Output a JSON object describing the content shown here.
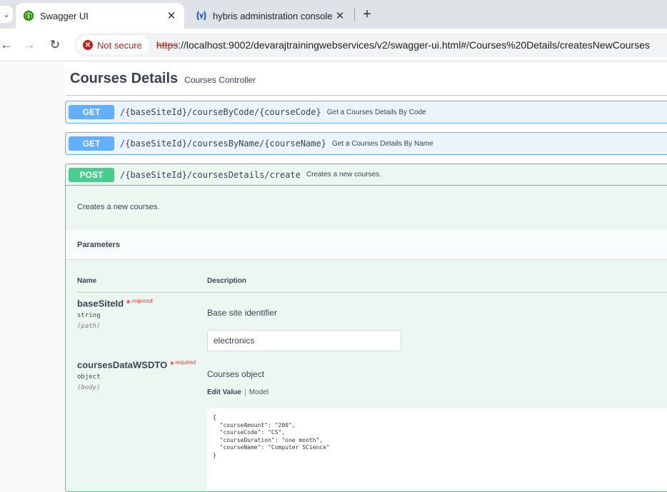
{
  "browser": {
    "tabs": [
      {
        "title": "Swagger UI",
        "active": true,
        "icon": "swagger-icon"
      },
      {
        "title": "hybris administration console |",
        "active": false,
        "icon": "hybris-icon"
      }
    ],
    "not_secure_label": "Not secure",
    "url_scheme": "https",
    "url_rest": "://localhost:9002/devarajtrainingwebservices/v2/swagger-ui.html#/Courses%20Details/createsNewCourses"
  },
  "section": {
    "title": "Courses Details",
    "subtitle": "Courses Controller"
  },
  "operations": [
    {
      "method": "GET",
      "path": "/{baseSiteId}/courseByCode/{courseCode}",
      "summary": "Get a Courses Details By Code"
    },
    {
      "method": "GET",
      "path": "/{baseSiteId}/coursesByName/{courseName}",
      "summary": "Get a Courses Details By Name"
    },
    {
      "method": "POST",
      "path": "/{baseSiteId}/coursesDetails/create",
      "summary": "Creates a new courses."
    }
  ],
  "post_detail": {
    "description": "Creates a new courses.",
    "parameters_label": "Parameters",
    "col_name": "Name",
    "col_description": "Description",
    "required_label": "required",
    "params": [
      {
        "name": "baseSiteId",
        "type": "string",
        "in": "(path)",
        "description": "Base site identifier",
        "value": "electronics"
      },
      {
        "name": "coursesDataWSDTO",
        "type": "object",
        "in": "(body)",
        "description": "Courses object"
      }
    ],
    "edit_value_label": "Edit Value",
    "model_label": "Model",
    "body_json": "{\n  \"courseAmount\": \"200\",\n  \"courseCode\": \"CS\",\n  \"courseDuration\": \"one month\",\n  \"courseName\": \"Computer SCience\"\n}"
  },
  "colors": {
    "get": "#61affe",
    "post": "#49cc90",
    "required": "#f93e3e"
  }
}
